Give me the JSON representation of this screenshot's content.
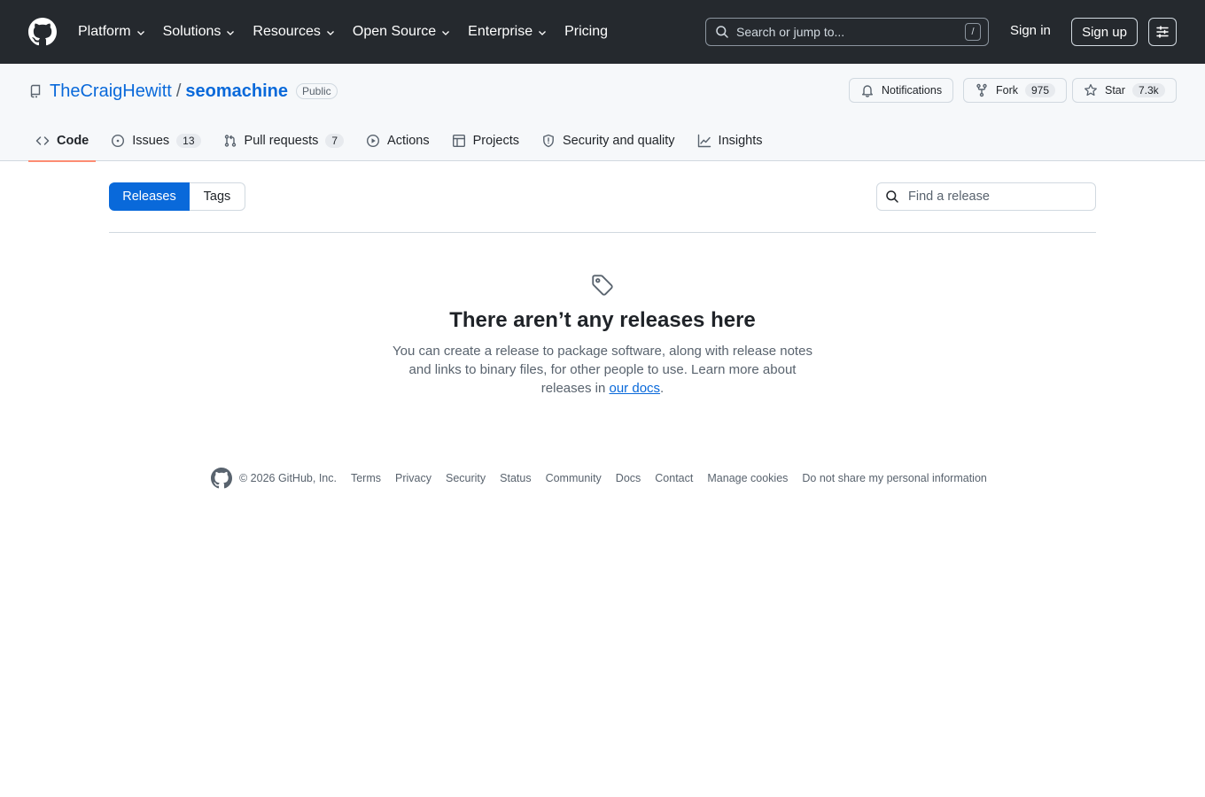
{
  "header": {
    "nav": [
      {
        "label": "Platform",
        "dropdown": true
      },
      {
        "label": "Solutions",
        "dropdown": true
      },
      {
        "label": "Resources",
        "dropdown": true
      },
      {
        "label": "Open Source",
        "dropdown": true
      },
      {
        "label": "Enterprise",
        "dropdown": true
      },
      {
        "label": "Pricing",
        "dropdown": false
      }
    ],
    "search_placeholder": "Search or jump to...",
    "search_shortcut": "/",
    "signin_label": "Sign in",
    "signup_label": "Sign up"
  },
  "repo": {
    "owner": "TheCraigHewitt",
    "separator": "/",
    "name": "seomachine",
    "visibility": "Public",
    "notifications_label": "Notifications",
    "fork_label": "Fork",
    "fork_count": "975",
    "star_label": "Star",
    "star_count": "7.3k"
  },
  "tabs": [
    {
      "label": "Code",
      "icon": "code-icon",
      "selected": true
    },
    {
      "label": "Issues",
      "icon": "issue-icon",
      "count": "13"
    },
    {
      "label": "Pull requests",
      "icon": "pull-request-icon",
      "count": "7"
    },
    {
      "label": "Actions",
      "icon": "play-icon"
    },
    {
      "label": "Projects",
      "icon": "table-icon"
    },
    {
      "label": "Security and quality",
      "icon": "shield-icon"
    },
    {
      "label": "Insights",
      "icon": "graph-icon"
    }
  ],
  "releases": {
    "releases_tab": "Releases",
    "tags_tab": "Tags",
    "find_placeholder": "Find a release",
    "blank_title": "There aren’t any releases here",
    "blank_text": "You can create a release to package software, along with release notes and links to binary files, for other people to use. Learn more about releases in ",
    "docs_link": "our docs",
    "blank_end": "."
  },
  "footer": {
    "copyright": "© 2026 GitHub, Inc.",
    "links": [
      "Terms",
      "Privacy",
      "Security",
      "Status",
      "Community",
      "Docs",
      "Contact",
      "Manage cookies",
      "Do not share my personal information"
    ]
  },
  "colors": {
    "header_bg": "#25292e",
    "repo_bg": "#f6f8fa",
    "link": "#0969da",
    "selected_tab_underline": "#fd8c73",
    "primary_button": "#0969da"
  }
}
